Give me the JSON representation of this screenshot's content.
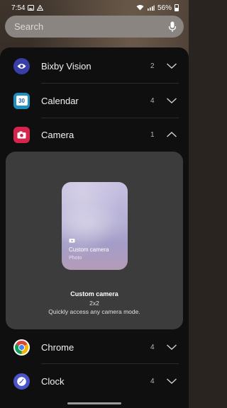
{
  "status_bar": {
    "time": "7:54",
    "battery": "56%"
  },
  "search": {
    "placeholder": "Search"
  },
  "apps": [
    {
      "name": "Bixby Vision",
      "count": "2",
      "icon": "bixby-vision-icon",
      "expanded": false
    },
    {
      "name": "Calendar",
      "count": "4",
      "icon": "calendar-icon",
      "icon_text": "30",
      "expanded": false
    },
    {
      "name": "Camera",
      "count": "1",
      "icon": "camera-icon",
      "expanded": true
    },
    {
      "name": "Chrome",
      "count": "4",
      "icon": "chrome-icon",
      "expanded": false
    },
    {
      "name": "Clock",
      "count": "4",
      "icon": "clock-icon",
      "expanded": false
    }
  ],
  "widget": {
    "preview_title": "Custom camera",
    "preview_subtitle": "Photo",
    "name": "Custom camera",
    "size": "2x2",
    "description": "Quickly access any camera mode."
  },
  "colors": {
    "panel": "#0f0f0f",
    "expanded_card": "#3c3c3c",
    "bixby": "#3a3fa8",
    "calendar": "#1f8fbf",
    "camera": "#d6244d",
    "clock": "#4b53c9"
  }
}
